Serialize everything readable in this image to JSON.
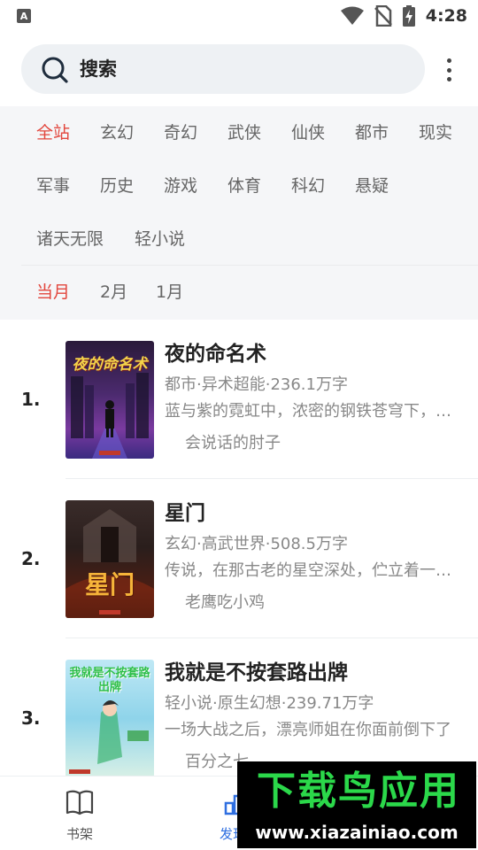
{
  "status_bar": {
    "time": "4:28",
    "app_icon_letter": "A"
  },
  "search": {
    "label": "搜索"
  },
  "categories": [
    {
      "label": "全站",
      "active": true
    },
    {
      "label": "玄幻",
      "active": false
    },
    {
      "label": "奇幻",
      "active": false
    },
    {
      "label": "武侠",
      "active": false
    },
    {
      "label": "仙侠",
      "active": false
    },
    {
      "label": "都市",
      "active": false
    },
    {
      "label": "现实",
      "active": false
    },
    {
      "label": "军事",
      "active": false
    },
    {
      "label": "历史",
      "active": false
    },
    {
      "label": "游戏",
      "active": false
    },
    {
      "label": "体育",
      "active": false
    },
    {
      "label": "科幻",
      "active": false
    },
    {
      "label": "悬疑",
      "active": false
    },
    {
      "label": "诸天无限",
      "active": false
    },
    {
      "label": "轻小说",
      "active": false
    }
  ],
  "periods": [
    {
      "label": "当月",
      "active": true
    },
    {
      "label": "2月",
      "active": false
    },
    {
      "label": "1月",
      "active": false
    }
  ],
  "books": [
    {
      "rank": "1.",
      "title": "夜的命名术",
      "meta": "都市·异术超能·236.1万字",
      "desc": "蓝与紫的霓虹中，浓密的钢铁苍穹下，数据洪流的前端",
      "author": "会说话的肘子",
      "cover_text": "夜的命名术"
    },
    {
      "rank": "2.",
      "title": "星门",
      "meta": "玄幻·高武世界·508.5万字",
      "desc": "传说，在那古老的星空深处，伫立着一道血与火的星门",
      "author": "老鹰吃小鸡",
      "cover_text": "星门"
    },
    {
      "rank": "3.",
      "title": "我就是不按套路出牌",
      "meta": "轻小说·原生幻想·239.71万字",
      "desc": "一场大战之后，漂亮师姐在你面前倒下了",
      "author": "百分之七",
      "cover_text": "我就是不按套路出牌"
    }
  ],
  "bottom_nav": [
    {
      "label": "书架",
      "icon": "book-open-icon",
      "active": false
    },
    {
      "label": "发现",
      "icon": "discover-icon",
      "active": true
    }
  ],
  "watermark": {
    "logo_text": "下载鸟应用",
    "url": "www.xiazainiao.com"
  },
  "colors": {
    "accent_red": "#e2463d",
    "active_blue": "#2f6fe0",
    "watermark_green": "#2bd84a"
  }
}
